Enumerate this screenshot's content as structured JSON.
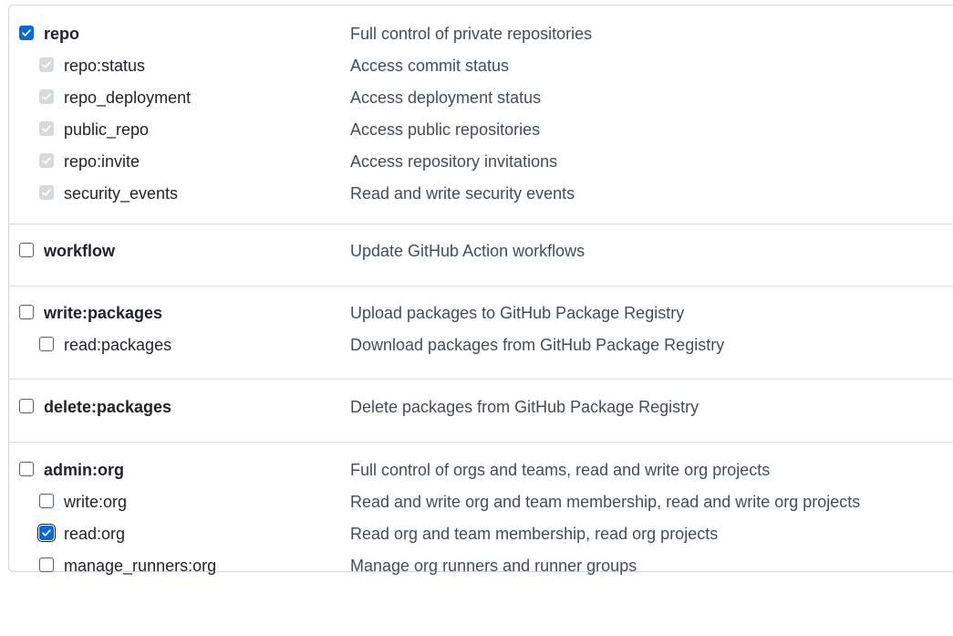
{
  "scopes": [
    {
      "parent": {
        "name": "repo",
        "description": "Full control of private repositories",
        "checked": true
      },
      "children": [
        {
          "name": "repo:status",
          "description": "Access commit status",
          "state": "disabled"
        },
        {
          "name": "repo_deployment",
          "description": "Access deployment status",
          "state": "disabled"
        },
        {
          "name": "public_repo",
          "description": "Access public repositories",
          "state": "disabled"
        },
        {
          "name": "repo:invite",
          "description": "Access repository invitations",
          "state": "disabled"
        },
        {
          "name": "security_events",
          "description": "Read and write security events",
          "state": "disabled"
        }
      ]
    },
    {
      "parent": {
        "name": "workflow",
        "description": "Update GitHub Action workflows",
        "checked": false
      },
      "children": []
    },
    {
      "parent": {
        "name": "write:packages",
        "description": "Upload packages to GitHub Package Registry",
        "checked": false
      },
      "children": [
        {
          "name": "read:packages",
          "description": "Download packages from GitHub Package Registry",
          "state": "unchecked"
        }
      ]
    },
    {
      "parent": {
        "name": "delete:packages",
        "description": "Delete packages from GitHub Package Registry",
        "checked": false
      },
      "children": []
    },
    {
      "parent": {
        "name": "admin:org",
        "description": "Full control of orgs and teams, read and write org projects",
        "checked": false
      },
      "children": [
        {
          "name": "write:org",
          "description": "Read and write org and team membership, read and write org projects",
          "state": "unchecked"
        },
        {
          "name": "read:org",
          "description": "Read org and team membership, read org projects",
          "state": "checked-focused"
        },
        {
          "name": "manage_runners:org",
          "description": "Manage org runners and runner groups",
          "state": "unchecked"
        }
      ]
    }
  ],
  "colors": {
    "accent": "#0969da",
    "disabled": "#d6d9dd",
    "border": "#d0d7de"
  },
  "icons": {
    "checkmark": "check-icon"
  }
}
